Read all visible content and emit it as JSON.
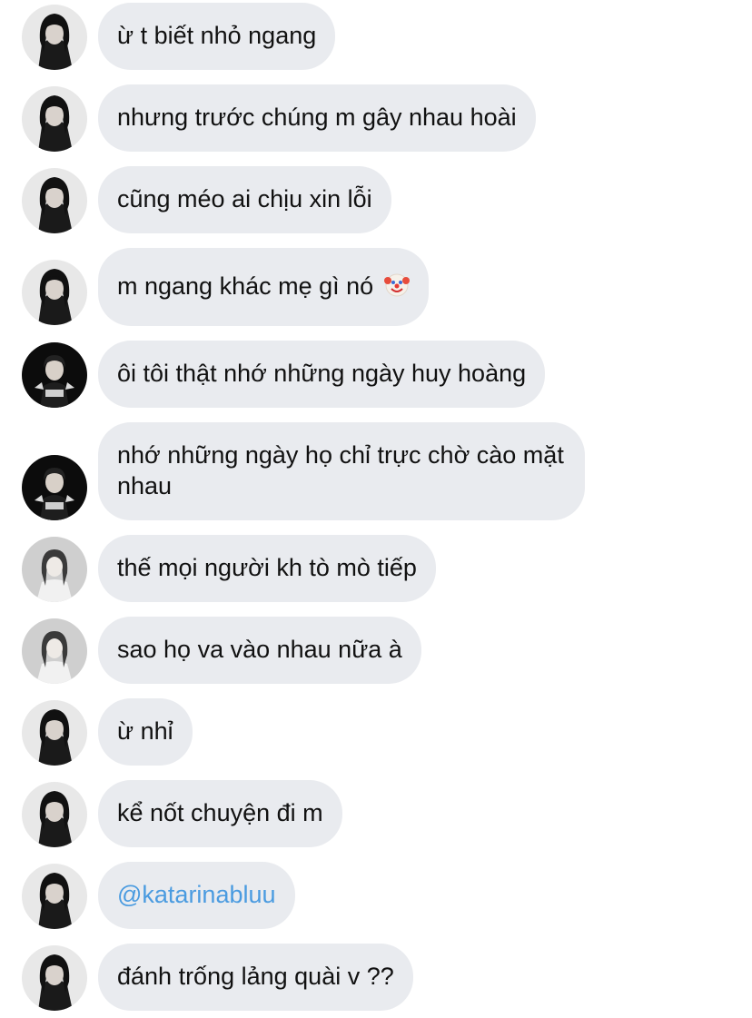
{
  "messages": [
    {
      "text": "ừ t biết nhỏ ngang",
      "avatar": "avatar-dark-hair-icon"
    },
    {
      "text": "nhưng trước chúng m gây nhau hoài",
      "avatar": "avatar-dark-hair-icon"
    },
    {
      "text": "cũng méo ai chịu xin lỗi",
      "avatar": "avatar-dark-hair-icon"
    },
    {
      "text": "m ngang khác mẹ gì nó",
      "emoji": "clown-face-icon",
      "avatar": "avatar-dark-hair-icon"
    },
    {
      "text": "ôi tôi thật nhớ những ngày huy hoàng",
      "avatar": "avatar-black-bg-icon"
    },
    {
      "text": "nhớ những ngày họ chỉ trực chờ cào mặt nhau",
      "avatar": "avatar-black-bg-icon"
    },
    {
      "text": "thế mọi người kh tò mò tiếp",
      "avatar": "avatar-light-portrait-icon"
    },
    {
      "text": "sao họ va vào nhau nữa à",
      "avatar": "avatar-light-portrait-icon"
    },
    {
      "text": "ừ nhỉ",
      "avatar": "avatar-dark-hair-icon"
    },
    {
      "text": "kể nốt chuyện đi m",
      "avatar": "avatar-dark-hair-icon"
    },
    {
      "text": "@katarinabluu",
      "avatar": "avatar-dark-hair-icon",
      "mention": true
    },
    {
      "text": "đánh trống lảng quài v ??",
      "avatar": "avatar-dark-hair-icon"
    }
  ],
  "colors": {
    "bubble_bg": "#e9ebef",
    "text": "#111111",
    "mention": "#4a9be0"
  }
}
